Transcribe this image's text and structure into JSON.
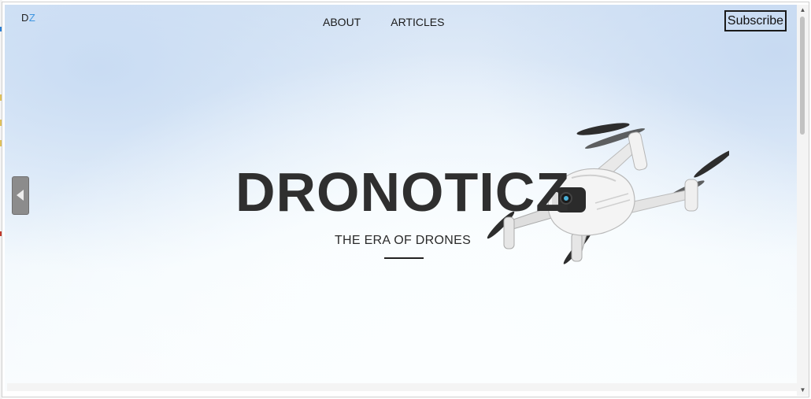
{
  "header": {
    "logo_first": "D",
    "logo_second": "Z",
    "nav": [
      {
        "label": "ABOUT"
      },
      {
        "label": "ARTICLES"
      }
    ],
    "subscribe_label": "Subscribe"
  },
  "hero": {
    "title": "DRONOTICZ",
    "subtitle": "THE ERA OF DRONES"
  },
  "icons": {
    "side_handle": "triangle-left-icon",
    "drone_image": "drone-photo",
    "scroll_up": "scroll-up-arrow",
    "scroll_down": "scroll-down-arrow"
  },
  "colors": {
    "logo_accent": "#3f95e0",
    "title": "#2f2f2f",
    "sky_top": "#d6e4f5",
    "sky_bottom": "#f9fcfe"
  }
}
